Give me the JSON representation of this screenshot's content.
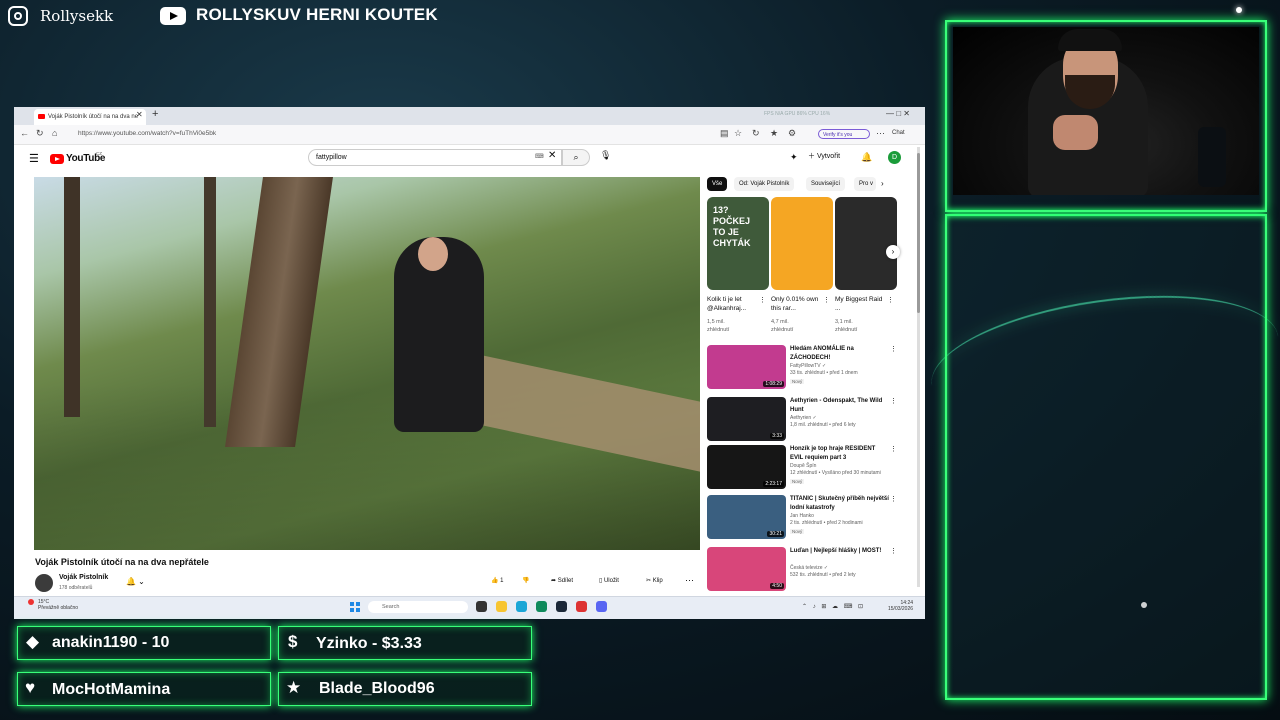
{
  "overlay": {
    "instagram_name": "Rollysekk",
    "youtube_channel": "ROLLYSKUV HERNI KOUTEK",
    "alerts": [
      {
        "icon": "diamond-icon",
        "text": "anakin1190 - 10"
      },
      {
        "icon": "dollar-icon",
        "text": "Yzinko - $3.33"
      },
      {
        "icon": "heart-icon",
        "text": "MocHotMamina"
      },
      {
        "icon": "star-icon",
        "text": "Blade_Blood96"
      }
    ],
    "accent_color": "#39ff79"
  },
  "browser": {
    "tab_title": "Voják Pistolník útočí na na dva ne",
    "url": "https://www.youtube.com/watch?v=fuThVi0e5bk",
    "verify_label": "Verify it's you",
    "chat_label": "Chat",
    "perf_text": "FPS N/A   GPU 86%   CPU 16%"
  },
  "youtube": {
    "logo_text": "YouTube",
    "logo_region": "CZ",
    "search_value": "fattypillow",
    "create_label": "Vytvořit",
    "avatar_letter": "D",
    "video": {
      "title": "Voják Pistolník útočí na na dva nepřátele",
      "channel": "Voják Pistolník",
      "subscribers": "178 odběratelů",
      "like_count": "1",
      "share_label": "Sdílet",
      "save_label": "Uložit",
      "clip_label": "Klip"
    },
    "chips": [
      "Vše",
      "Od: Voják Pistolník",
      "Související",
      "Pro v"
    ],
    "shorts": [
      {
        "title": "Kolik ti je let @Alkanhraj...",
        "views": "1,5 mil.",
        "views2": "zhlédnutí",
        "thumb_text": "13?\nPOČKEJ TO JE CHYTÁK",
        "color": "#3f5a3a"
      },
      {
        "title": "Only 0.01% own this rar...",
        "views": "4,7 mil.",
        "views2": "zhlédnutí",
        "thumb_text": "",
        "color": "#f5a623"
      },
      {
        "title": "My Biggest Raid ...",
        "views": "3,1 mil.",
        "views2": "zhlédnutí",
        "thumb_text": "",
        "color": "#2a2a2a"
      }
    ],
    "recommendations": [
      {
        "title": "Hledám ANOMÁLIE na ZÁCHODECH!",
        "channel": "FattyPillowTV ✓",
        "meta": "33 tis. zhlédnutí • před 1 dnem",
        "badge": "Nový",
        "duration": "1:08:29",
        "color": "#c23b8f"
      },
      {
        "title": "Aethyrien - Odenspakt, The Wild Hunt",
        "channel": "Aethyrien ✓",
        "meta": "1,8 mil. zhlédnutí • před 6 lety",
        "badge": "",
        "duration": "3:33",
        "color": "#1e1e22"
      },
      {
        "title": "Honzík je top hraje RESIDENT EVIL requiem part 3",
        "channel": "Doupě Špín",
        "meta": "12 zhlédnutí • Vysíláno před 30 minutami",
        "badge": "Nový",
        "duration": "2:23:17",
        "color": "#161616"
      },
      {
        "title": "TITANIC | Skutečný příběh největší lodní katastrofy",
        "channel": "Jan Hanko",
        "meta": "2 tis. zhlédnutí • před 2 hodinami",
        "badge": "Nový",
        "duration": "30:21",
        "color": "#3a5f80"
      },
      {
        "title": "Luďan | Nejlepší hlášky | MOST!",
        "channel": "Česká televize ✓",
        "meta": "532 tis. zhlédnutí • před 2 lety",
        "badge": "",
        "duration": "4:50",
        "color": "#d8467a"
      }
    ]
  },
  "taskbar": {
    "weather_temp": "15°C",
    "weather_desc": "Převážně oblačno",
    "search_placeholder": "Search",
    "time": "14:24",
    "date": "15/03/2026"
  }
}
